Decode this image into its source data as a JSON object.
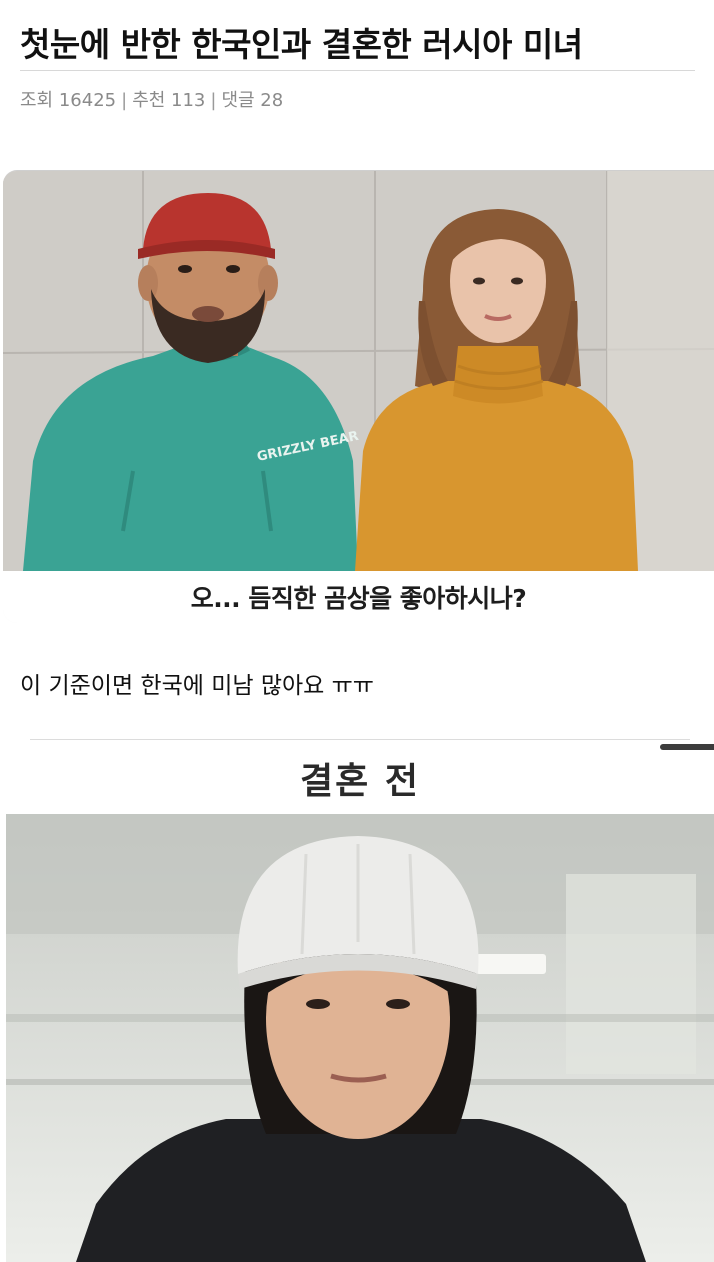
{
  "post": {
    "title": "첫눈에 반한 한국인과 결혼한 러시아 미녀",
    "meta": {
      "views": "조회 16425",
      "recommends": "추천 113",
      "comments": "댓글 28",
      "separator": "|"
    },
    "images": [
      {
        "subtitle": "오... 듬직한 곰상을 좋아하시나?"
      },
      {
        "caption": "결혼 전"
      }
    ],
    "body_text": "이 기준이면 한국에 미남 많아요 ㅠㅠ"
  },
  "colors": {
    "teal_sweatshirt": "#3aa394",
    "mustard_turtleneck": "#d8962f",
    "red_cap": "#b8342e",
    "white_beanie": "#ececea",
    "meta_gray": "#8a8a8a"
  }
}
